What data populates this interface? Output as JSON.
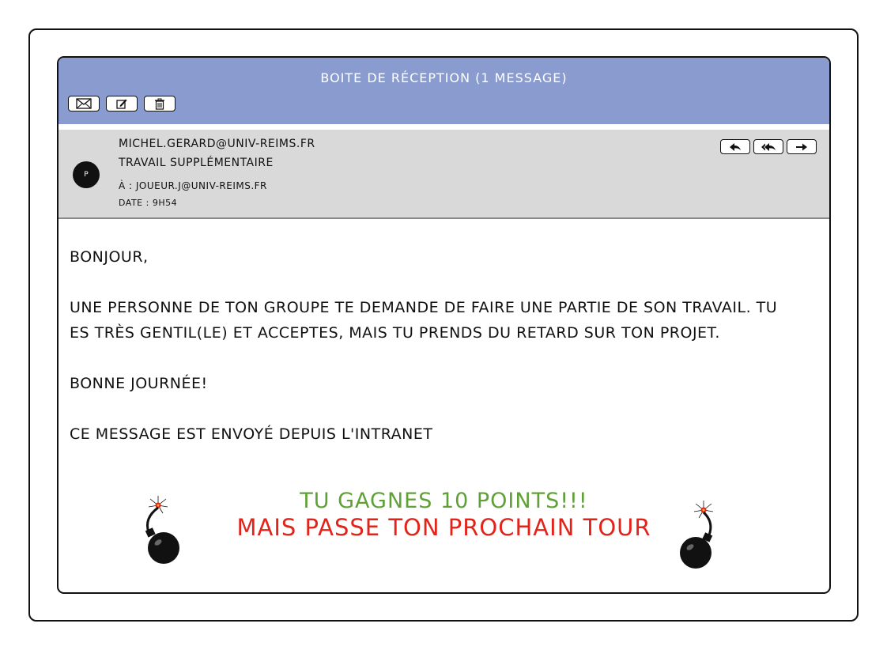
{
  "window": {
    "title": "Boite de réception  (1 message)"
  },
  "toolbar": {
    "buttons": [
      {
        "icon": "envelope-icon"
      },
      {
        "icon": "compose-icon"
      },
      {
        "icon": "trash-icon"
      }
    ]
  },
  "email": {
    "avatar_initial": "P",
    "from": "michel.gerard@univ-reims.fr",
    "subject": "Travail supplémentaire",
    "to": "À : joueur.j@univ-reims.fr",
    "date": "Date : 9h54",
    "actions": [
      {
        "icon": "reply-icon"
      },
      {
        "icon": "reply-all-icon"
      },
      {
        "icon": "forward-icon"
      }
    ]
  },
  "body": {
    "greeting": "Bonjour,",
    "paragraph": "Une personne de ton groupe te demande de faire une partie de son travail. Tu es très gentil(le) et acceptes, mais tu prends du retard sur ton projet.",
    "closing": "Bonne journée!",
    "footer": "Ce message est envoyé depuis l'intranet"
  },
  "promo": {
    "line1": "Tu gagnes 10 points!!!",
    "line2": "Mais passe ton prochain tour",
    "line1_color": "#5fa136",
    "line2_color": "#e2231a",
    "decor_icon": "bomb-icon"
  },
  "colors": {
    "title_bar": "#8a9ccf",
    "header_panel": "#d9d9d9"
  }
}
